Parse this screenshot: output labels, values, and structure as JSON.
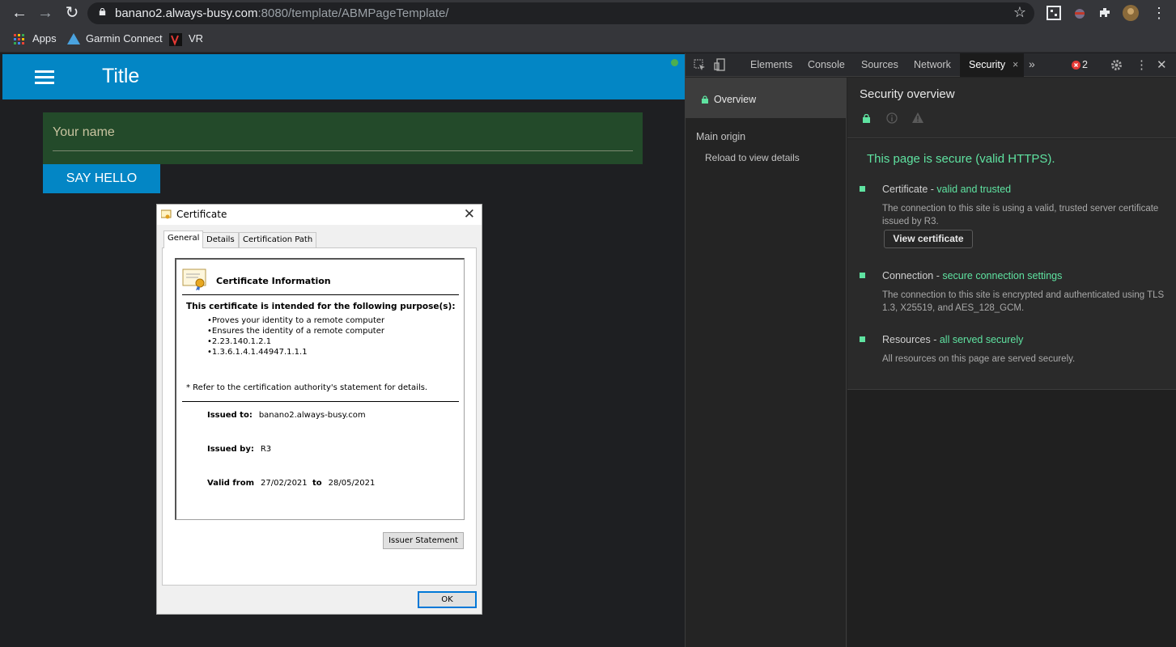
{
  "browser": {
    "url_host": "banano2.always-busy.com",
    "url_rest": ":8080/template/ABMPageTemplate/",
    "bookmarks": [
      "Apps",
      "Garmin Connect",
      "VR"
    ]
  },
  "app": {
    "title": "Title",
    "name_placeholder": "Your name",
    "say_hello": "SAY HELLO"
  },
  "certificate": {
    "window_title": "Certificate",
    "tabs": [
      "General",
      "Details",
      "Certification Path"
    ],
    "info_title": "Certificate Information",
    "purpose_title": "This certificate is intended for the following purpose(s):",
    "purposes": [
      "Proves your identity to a remote computer",
      "Ensures the identity of a remote computer",
      "2.23.140.1.2.1",
      "1.3.6.1.4.1.44947.1.1.1"
    ],
    "refer_note": "* Refer to the certification authority's statement for details.",
    "issued_to_label": "Issued to:",
    "issued_to": "banano2.always-busy.com",
    "issued_by_label": "Issued by:",
    "issued_by": "R3",
    "valid_from_label": "Valid from",
    "valid_from": "27/02/2021",
    "to_label": "to",
    "valid_to": "28/05/2021",
    "issuer_statement": "Issuer Statement",
    "ok": "OK"
  },
  "devtools": {
    "tabs": [
      "Elements",
      "Console",
      "Sources",
      "Network",
      "Security"
    ],
    "error_count": "2",
    "sidebar": {
      "overview": "Overview",
      "main_origin": "Main origin",
      "reload": "Reload to view details"
    },
    "security": {
      "title": "Security overview",
      "summary": "This page is secure (valid HTTPS).",
      "cert_label": "Certificate - ",
      "cert_status": "valid and trusted",
      "cert_desc": "The connection to this site is using a valid, trusted server certificate issued by R3.",
      "view_cert": "View certificate",
      "conn_label": "Connection - ",
      "conn_status": "secure connection settings",
      "conn_desc": "The connection to this site is encrypted and authenticated using TLS 1.3, X25519, and AES_128_GCM.",
      "res_label": "Resources - ",
      "res_status": "all served securely",
      "res_desc": "All resources on this page are served securely."
    },
    "accent": "#5fe3a1"
  }
}
